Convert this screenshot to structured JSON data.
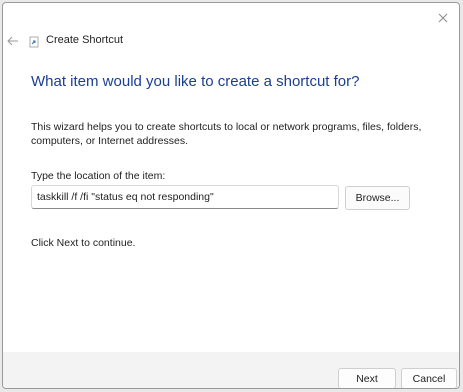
{
  "window": {
    "title": "Create Shortcut",
    "close_icon": "close-icon",
    "back_icon": "back-arrow-icon",
    "app_icon": "shortcut-icon"
  },
  "content": {
    "heading": "What item would you like to create a shortcut for?",
    "description": "This wizard helps you to create shortcuts to local or network programs, files, folders, computers, or Internet addresses.",
    "location_label": "Type the location of the item:",
    "location_value": "taskkill /f /fi \"status eq not responding\"",
    "browse_label": "Browse...",
    "continue_text": "Click Next to continue."
  },
  "footer": {
    "next_label": "Next",
    "cancel_label": "Cancel"
  },
  "colors": {
    "heading": "#1b3f8f",
    "footer_background": "#f3f3f3"
  }
}
